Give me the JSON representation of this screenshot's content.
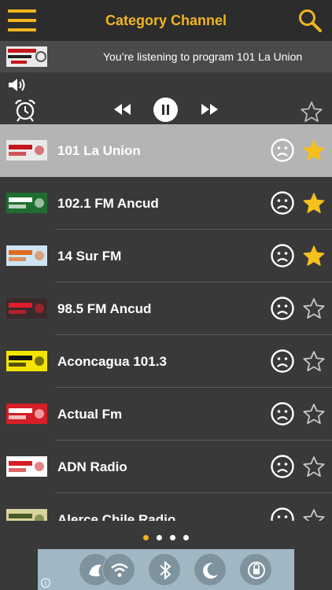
{
  "header": {
    "title": "Category Channel",
    "accent": "#f2b51f"
  },
  "now_playing": {
    "text": "You’re listening to program 101 La Union",
    "logo_icon": "station-logo-101-la-union"
  },
  "controls": {
    "volume_icon": "speaker-icon",
    "alarm_icon": "alarm-clock-icon",
    "rewind_icon": "rewind-icon",
    "pause_icon": "pause-icon",
    "forward_icon": "fast-forward-icon",
    "favorite_icon": "star-outline-icon"
  },
  "stations": [
    {
      "name": "101 La Union",
      "favorite": true,
      "selected": true,
      "logo": {
        "bg": "#e9e9e9",
        "fg": "#c4161c"
      }
    },
    {
      "name": "102.1 FM Ancud",
      "favorite": true,
      "selected": false,
      "logo": {
        "bg": "#1f6d2f",
        "fg": "#ffffff"
      }
    },
    {
      "name": "14 Sur FM",
      "favorite": true,
      "selected": false,
      "logo": {
        "bg": "#cfe4f2",
        "fg": "#e06b1c"
      }
    },
    {
      "name": "98.5 FM Ancud",
      "favorite": false,
      "selected": false,
      "logo": {
        "bg": "#3a2a2a",
        "fg": "#e31d2c"
      }
    },
    {
      "name": "Aconcagua 101.3",
      "favorite": false,
      "selected": false,
      "logo": {
        "bg": "#f5e400",
        "fg": "#111111"
      }
    },
    {
      "name": "Actual Fm",
      "favorite": false,
      "selected": false,
      "logo": {
        "bg": "#d41f26",
        "fg": "#ffffff"
      }
    },
    {
      "name": "ADN Radio",
      "favorite": false,
      "selected": false,
      "logo": {
        "bg": "#ffffff",
        "fg": "#d41f26"
      }
    },
    {
      "name": "Alerce Chile Radio",
      "favorite": false,
      "selected": false,
      "logo": {
        "bg": "#d8d39a",
        "fg": "#4a5a2a"
      }
    }
  ],
  "page_dots": {
    "count": 4,
    "active": 0
  },
  "ad": {
    "info_label": "i",
    "icons": [
      "app-icon",
      "wifi-icon",
      "bluetooth-icon",
      "moon-icon",
      "rotation-lock-icon"
    ]
  }
}
